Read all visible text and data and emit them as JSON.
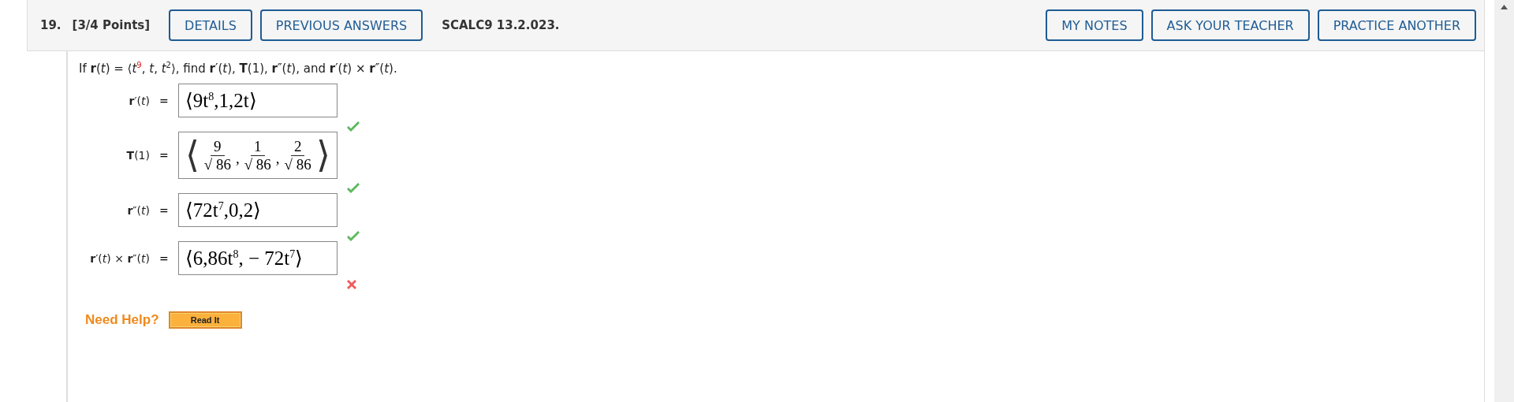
{
  "header": {
    "number": "19.",
    "points": "[3/4 Points]",
    "left_buttons": [
      "DETAILS",
      "PREVIOUS ANSWERS"
    ],
    "code": "SCALC9 13.2.023.",
    "right_buttons": [
      "MY NOTES",
      "ASK YOUR TEACHER",
      "PRACTICE ANOTHER"
    ]
  },
  "question": "If **r**(*t*) = ⟨*t*$^{9}$, *t*, *t*$^{2}$⟩, find **r**′(*t*), **T**(1), **r**″(*t*), and **r**′(*t*) × **r**″(*t*).",
  "answers": [
    {
      "kind": "vector",
      "label": "**r**′(*t*)",
      "equals": "=",
      "value": "⟨9t$^{8}$,1,2t⟩",
      "correct": true
    },
    {
      "kind": "fractions",
      "label": "**T**(1)",
      "equals": "=",
      "open": "⟨",
      "close": "⟩",
      "fractions": [
        {
          "numerator": "9",
          "denominator": "√ 86"
        },
        {
          "numerator": "1",
          "denominator": "√ 86"
        },
        {
          "numerator": "2",
          "denominator": "√ 86"
        }
      ],
      "separator": ",",
      "correct": true
    },
    {
      "kind": "vector",
      "label": "**r**″(*t*)",
      "equals": "=",
      "value": "⟨72t$^{7}$,0,2⟩",
      "correct": true
    },
    {
      "kind": "vector",
      "label": "**r**′(*t*) × **r**″(*t*)",
      "equals": "=",
      "value": "⟨6,86t$^{8}$, − 72t$^{7}$⟩",
      "correct": false
    }
  ],
  "help": {
    "label": "Need Help?",
    "button": "Read It"
  }
}
